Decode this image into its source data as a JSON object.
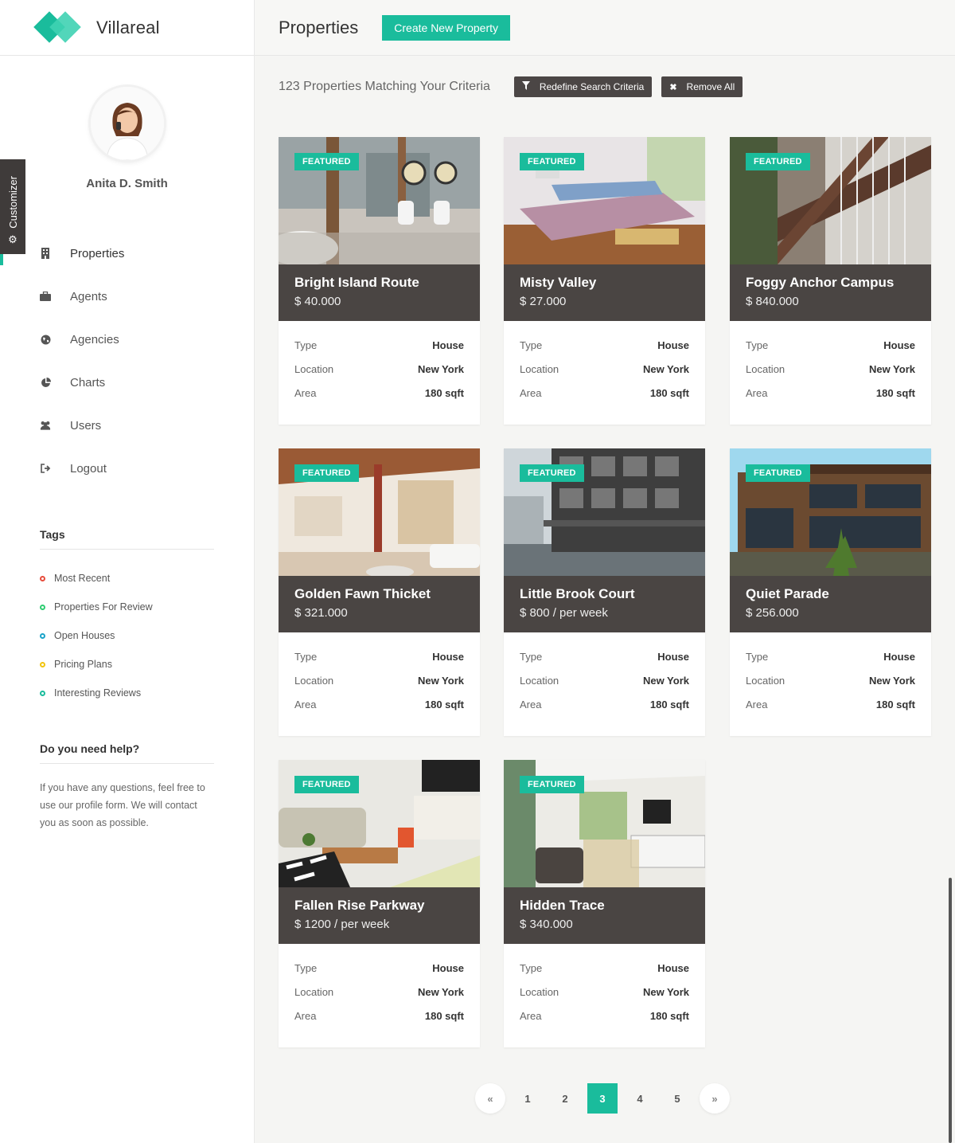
{
  "brand": {
    "name": "Villareal",
    "logo_icon": "diamond-logo-icon",
    "accent_color": "#1abc9c"
  },
  "customizer": {
    "label": "Customizer",
    "icon": "gear-icon"
  },
  "profile": {
    "name": "Anita D. Smith"
  },
  "nav": [
    {
      "label": "Properties",
      "icon": "building-icon",
      "active": true
    },
    {
      "label": "Agents",
      "icon": "briefcase-icon"
    },
    {
      "label": "Agencies",
      "icon": "globe-icon"
    },
    {
      "label": "Charts",
      "icon": "pie-chart-icon"
    },
    {
      "label": "Users",
      "icon": "users-icon"
    },
    {
      "label": "Logout",
      "icon": "logout-icon"
    }
  ],
  "tags": {
    "title": "Tags",
    "items": [
      {
        "label": "Most Recent",
        "color": "#e74c3c"
      },
      {
        "label": "Properties For Review",
        "color": "#2ecc71"
      },
      {
        "label": "Open Houses",
        "color": "#1aa3c9"
      },
      {
        "label": "Pricing Plans",
        "color": "#f1c40f"
      },
      {
        "label": "Interesting Reviews",
        "color": "#1abc9c"
      }
    ]
  },
  "help": {
    "title": "Do you need help?",
    "text": "If you have any questions, feel free to use our profile form. We will contact you as soon as possible."
  },
  "header": {
    "title": "Properties",
    "create_button": "Create New Property"
  },
  "results": {
    "count_text": "123 Properties Matching Your Criteria",
    "redefine_label": "Redefine Search Criteria",
    "remove_label": "Remove All"
  },
  "spec_labels": {
    "type": "Type",
    "location": "Location",
    "area": "Area"
  },
  "properties": [
    {
      "badge": "FEATURED",
      "name": "Bright Island Route",
      "price": "$ 40.000",
      "type": "House",
      "location": "New York",
      "area": "180 sqft"
    },
    {
      "badge": "FEATURED",
      "name": "Misty Valley",
      "price": "$ 27.000",
      "type": "House",
      "location": "New York",
      "area": "180 sqft"
    },
    {
      "badge": "FEATURED",
      "name": "Foggy Anchor Campus",
      "price": "$ 840.000",
      "type": "House",
      "location": "New York",
      "area": "180 sqft"
    },
    {
      "badge": "FEATURED",
      "name": "Golden Fawn Thicket",
      "price": "$ 321.000",
      "type": "House",
      "location": "New York",
      "area": "180 sqft"
    },
    {
      "badge": "FEATURED",
      "name": "Little Brook Court",
      "price": "$ 800 / per week",
      "type": "House",
      "location": "New York",
      "area": "180 sqft"
    },
    {
      "badge": "FEATURED",
      "name": "Quiet Parade",
      "price": "$ 256.000",
      "type": "House",
      "location": "New York",
      "area": "180 sqft"
    },
    {
      "badge": "FEATURED",
      "name": "Fallen Rise Parkway",
      "price": "$ 1200 / per week",
      "type": "House",
      "location": "New York",
      "area": "180 sqft"
    },
    {
      "badge": "FEATURED",
      "name": "Hidden Trace",
      "price": "$ 340.000",
      "type": "House",
      "location": "New York",
      "area": "180 sqft"
    }
  ],
  "pagination": {
    "prev": "«",
    "next": "»",
    "pages": [
      "1",
      "2",
      "3",
      "4",
      "5"
    ],
    "current": "3"
  }
}
